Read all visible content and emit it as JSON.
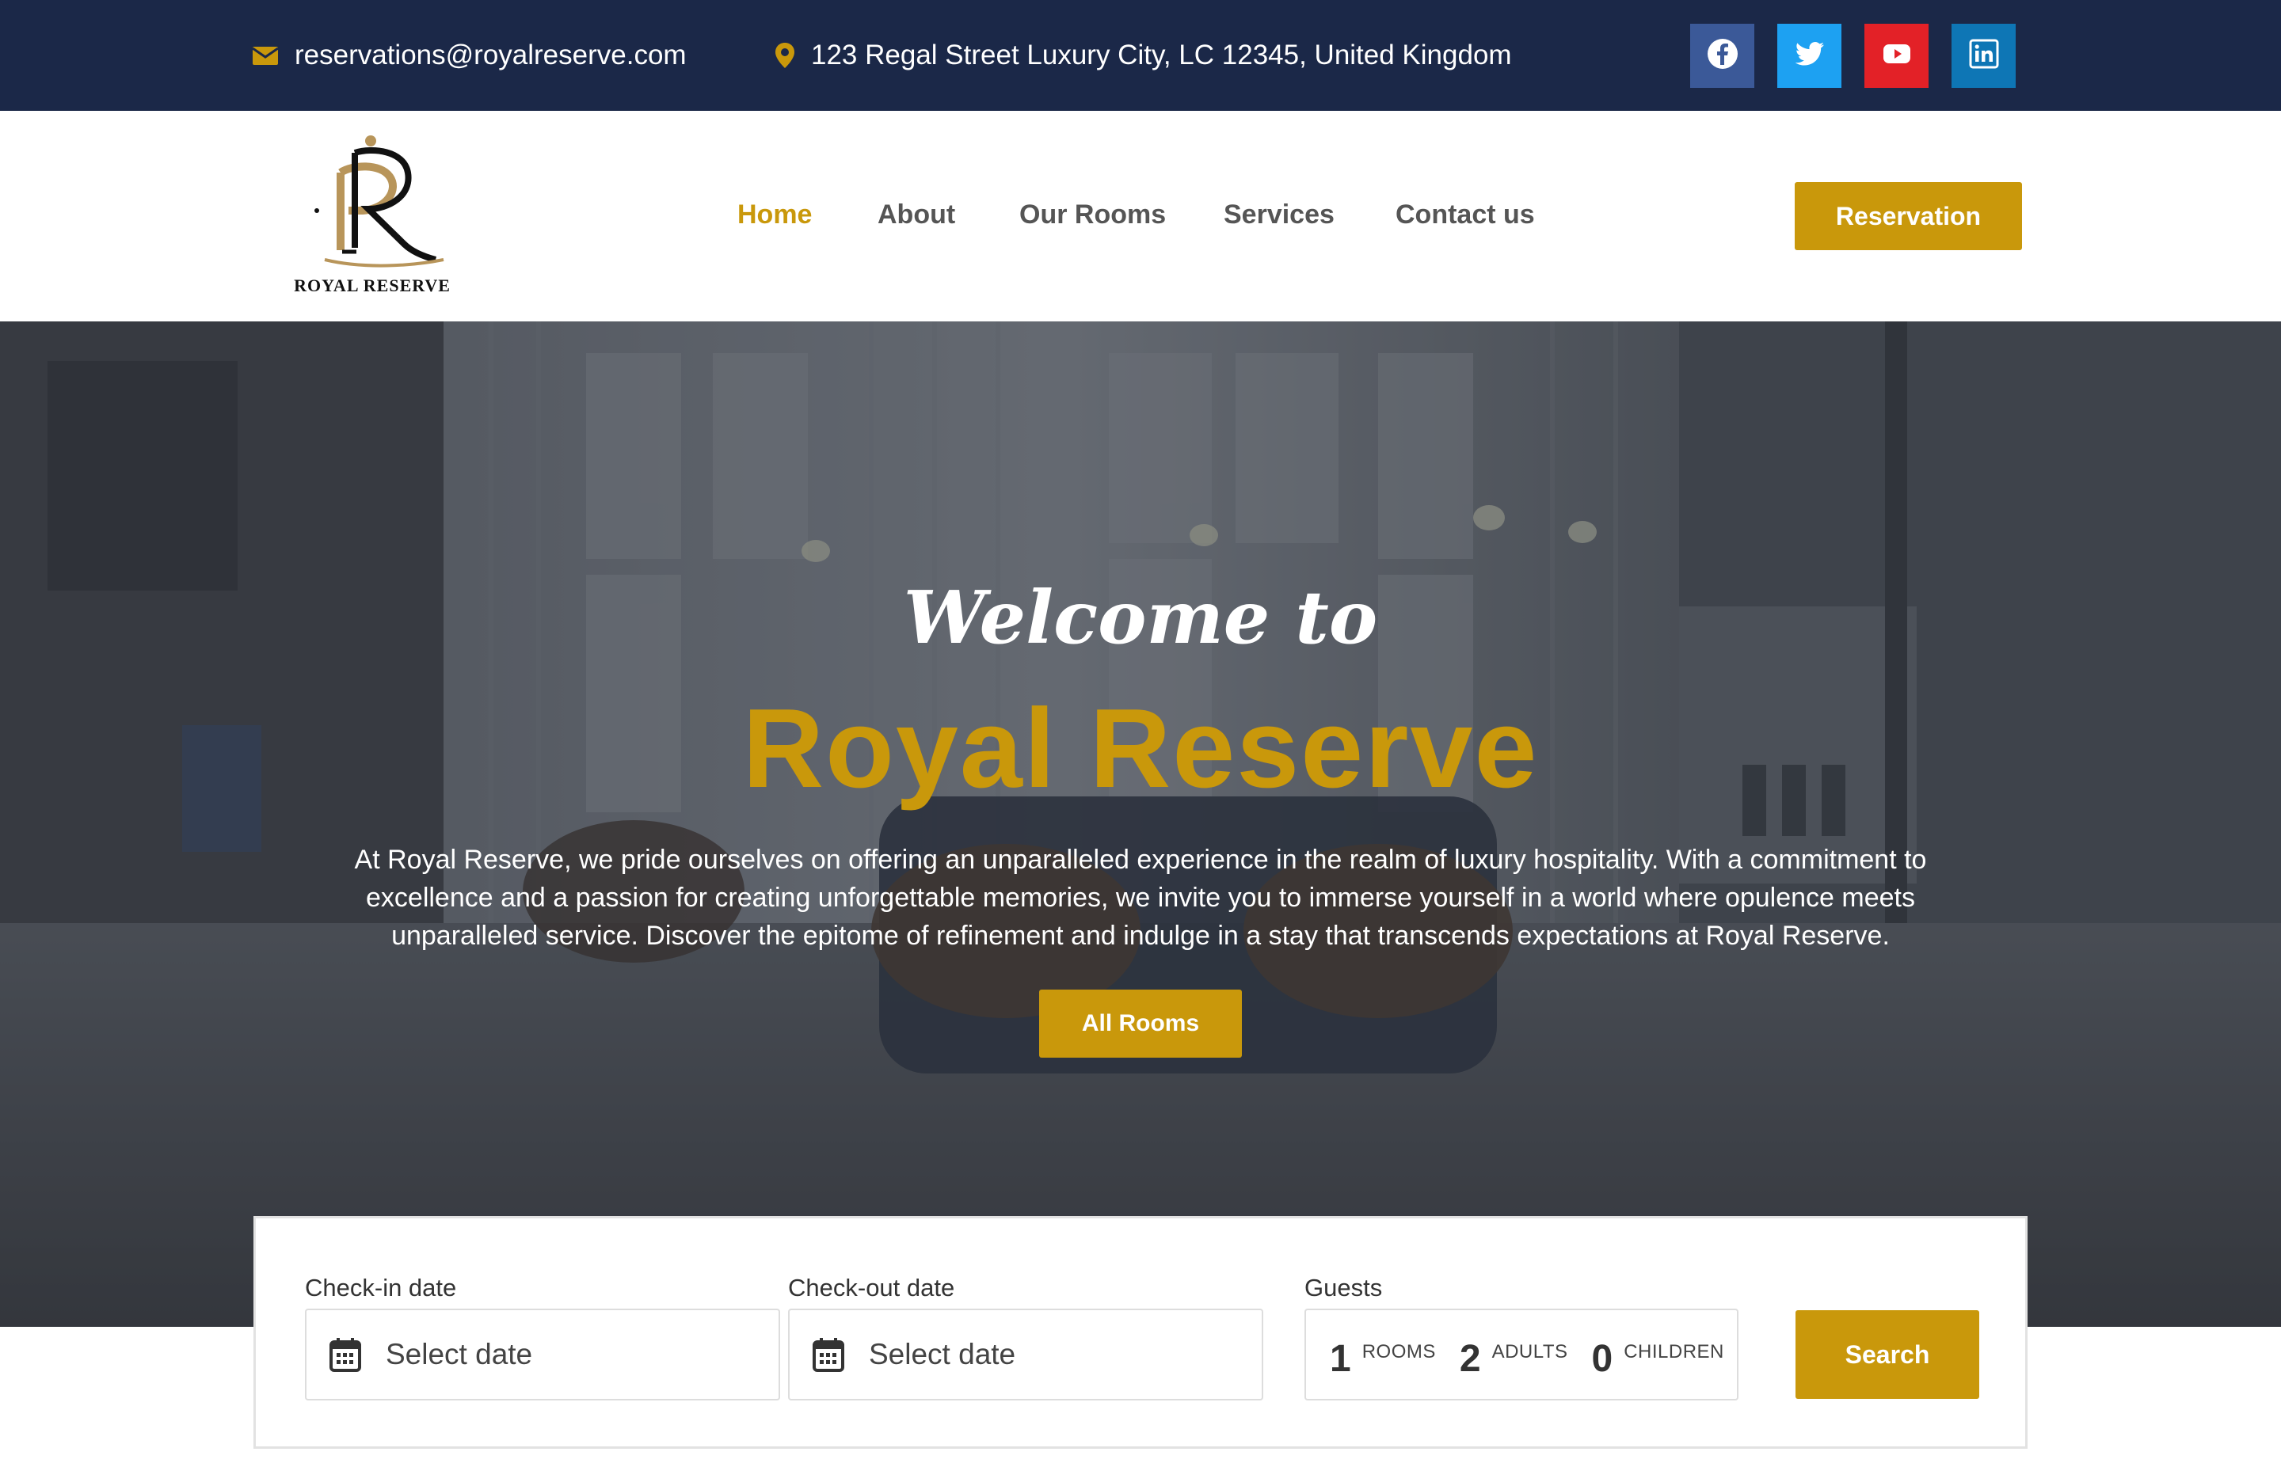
{
  "topbar": {
    "email": "reservations@royalreserve.com",
    "address": "123 Regal Street Luxury City, LC 12345, United Kingdom",
    "email_icon": "envelope-icon",
    "address_icon": "map-pin-icon",
    "social": [
      {
        "name": "facebook-icon",
        "color": "#3b5998"
      },
      {
        "name": "twitter-icon",
        "color": "#1da1f2"
      },
      {
        "name": "youtube-icon",
        "color": "#cd201f"
      },
      {
        "name": "linkedin-icon",
        "color": "#0077b5"
      }
    ]
  },
  "header": {
    "logo_text": "ROYAL RESERVE",
    "nav": [
      "Home",
      "About",
      "Our Rooms",
      "Services",
      "Contact us"
    ],
    "active_nav": "Home",
    "reservation_label": "Reservation"
  },
  "hero": {
    "welcome": "Welcome to",
    "title": "Royal Reserve",
    "description": "At Royal Reserve, we pride ourselves on offering an unparalleled experience in the realm of luxury hospitality. With a commitment to excellence and a passion for creating unforgettable memories, we invite you to immerse yourself in a world where opulence meets unparalleled service. Discover the epitome of refinement and indulge in a stay that transcends expectations at Royal Reserve.",
    "button_label": "All Rooms"
  },
  "booking": {
    "checkin_label": "Check-in date",
    "checkin_placeholder": "Select date",
    "checkout_label": "Check-out date",
    "checkout_placeholder": "Select date",
    "guests_label": "Guests",
    "rooms_value": "1",
    "rooms_label": "ROOMS",
    "adults_value": "2",
    "adults_label": "ADULTS",
    "children_value": "0",
    "children_label": "CHILDREN",
    "search_label": "Search"
  },
  "colors": {
    "accent": "#c9980b",
    "topbar": "#1b2848",
    "nav_text": "#555555"
  }
}
